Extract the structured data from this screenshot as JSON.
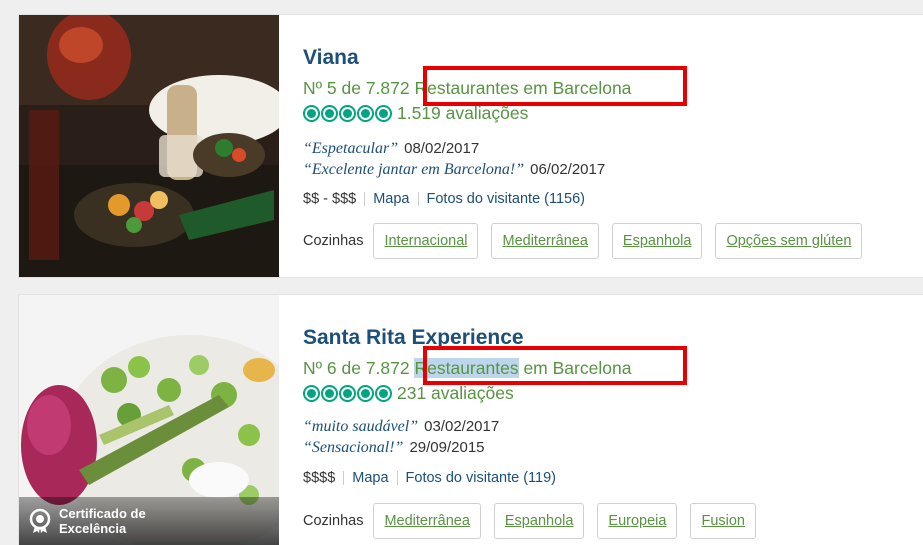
{
  "listings": [
    {
      "name": "Viana",
      "rank_prefix": "Nº 5 de 7.872",
      "rank_link": "Restaurantes em Barcelona",
      "reviews": "1.519 avaliações",
      "rating_bubbles": 5,
      "quotes": [
        {
          "text": "“Espetacular”",
          "date": "08/02/2017"
        },
        {
          "text": "“Excelente jantar em Barcelona!”",
          "date": "06/02/2017"
        }
      ],
      "price": "$$ - $$$",
      "map": "Mapa",
      "photos": "Fotos do visitante (1156)",
      "cuisine_label": "Cozinhas",
      "cuisines": [
        "Internacional",
        "Mediterrânea",
        "Espanhola",
        "Opções sem glúten"
      ]
    },
    {
      "name": "Santa Rita Experience",
      "rank_prefix": "Nº 6 de 7.872",
      "rank_link_highlighted": "Restaurantes",
      "rank_link_rest": "em Barcelona",
      "reviews": "231 avaliações",
      "rating_bubbles": 5,
      "quotes": [
        {
          "text": "“muito saudável”",
          "date": "03/02/2017"
        },
        {
          "text": "“Sensacional!”",
          "date": "29/09/2015"
        }
      ],
      "price": "$$$$",
      "map": "Mapa",
      "photos": "Fotos do visitante (119)",
      "cuisine_label": "Cozinhas",
      "cuisines": [
        "Mediterrânea",
        "Espanhola",
        "Europeia",
        "Fusion"
      ],
      "certificate_line1": "Certificado de",
      "certificate_line2": "Excelência"
    }
  ],
  "colors": {
    "title": "#1c4f7a",
    "green_link": "#589442",
    "bubble": "#00a680",
    "annotation_box": "#e60000",
    "selection": "#bdd6ee"
  }
}
